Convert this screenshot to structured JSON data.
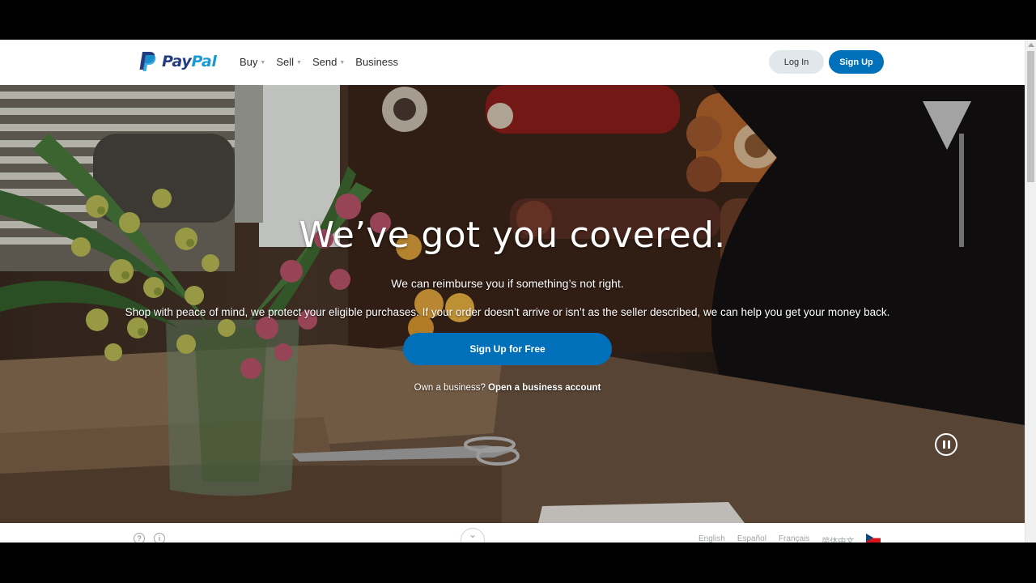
{
  "header": {
    "logo_text_1": "Pay",
    "logo_text_2": "Pal",
    "nav": [
      {
        "label": "Buy",
        "has_dropdown": true
      },
      {
        "label": "Sell",
        "has_dropdown": true
      },
      {
        "label": "Send",
        "has_dropdown": true
      },
      {
        "label": "Business",
        "has_dropdown": false
      }
    ],
    "login_label": "Log In",
    "signup_label": "Sign Up"
  },
  "hero": {
    "title": "We’ve got you covered.",
    "subtitle": "We can reimburse you if something’s not right.",
    "description": "Shop with peace of mind, we protect your eligible purchases. If your order doesn’t arrive or isn’t as the seller described, we can help you get your money back.",
    "cta_label": "Sign Up for Free",
    "business_prompt": "Own a business?",
    "business_link": "Open a business account",
    "pause_icon": "pause-icon"
  },
  "footer": {
    "help_icon_text": "?",
    "info_icon_text": "i",
    "languages": [
      "English",
      "Español",
      "Français",
      "简体中文"
    ],
    "flag_icon": "czech-flag-icon",
    "scroll_icon": "chevron-down-icon"
  },
  "colors": {
    "brand_blue": "#0070ba",
    "logo_dark": "#253b80",
    "logo_light": "#179bd7",
    "login_bg": "#e1e7eb"
  }
}
